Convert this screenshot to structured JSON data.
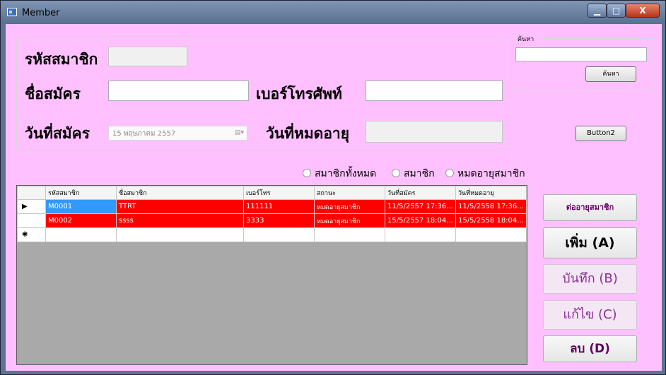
{
  "window": {
    "title": "Member",
    "min_label": "▁",
    "max_label": "□",
    "close_label": "X"
  },
  "form": {
    "member_id_label": "รหัสสมาชิก",
    "member_id_value": "",
    "name_label": "ชื่อสมัคร",
    "name_value": "",
    "phone_label": "เบอร์โทรศัพท์",
    "phone_value": "",
    "join_date_label": "วันที่สมัคร",
    "join_date_value": "15 พฤษภาคม    2557",
    "expire_label": "วันที่หมดอายุ",
    "expire_value": ""
  },
  "search": {
    "group_label": "ค้นหา",
    "input_value": "",
    "button_label": "ค้นหา"
  },
  "button2_label": "Button2",
  "filters": {
    "all": "สมาชิกทั้งหมด",
    "member": "สมาชิก",
    "expired": "หมดอายุสมาชิก"
  },
  "table": {
    "headers": [
      "รหัสสมาชิก",
      "ชื่อสมาชิก",
      "เบอร์โทร",
      "สถานะ",
      "วันที่สมัคร",
      "วันที่หมดอายุ"
    ],
    "rows": [
      [
        "M0001",
        "TTRT",
        "111111",
        "หมดอายุสมาชิก",
        "11/5/2557 17:36...",
        "11/5/2558 17:36..."
      ],
      [
        "M0002",
        "ssss",
        "3333",
        "หมดอายุสมาชิก",
        "15/5/2557 18:04...",
        "15/5/2558 18:04..."
      ]
    ],
    "current_row_marker": "▶",
    "new_row_marker": "✱"
  },
  "actions": {
    "renew": "ต่ออายุสมาชิก",
    "add": "เพิ่ม (A)",
    "save": "บันทึก (B)",
    "edit": "แก้ไข (C)",
    "delete": "ลบ (D)"
  }
}
